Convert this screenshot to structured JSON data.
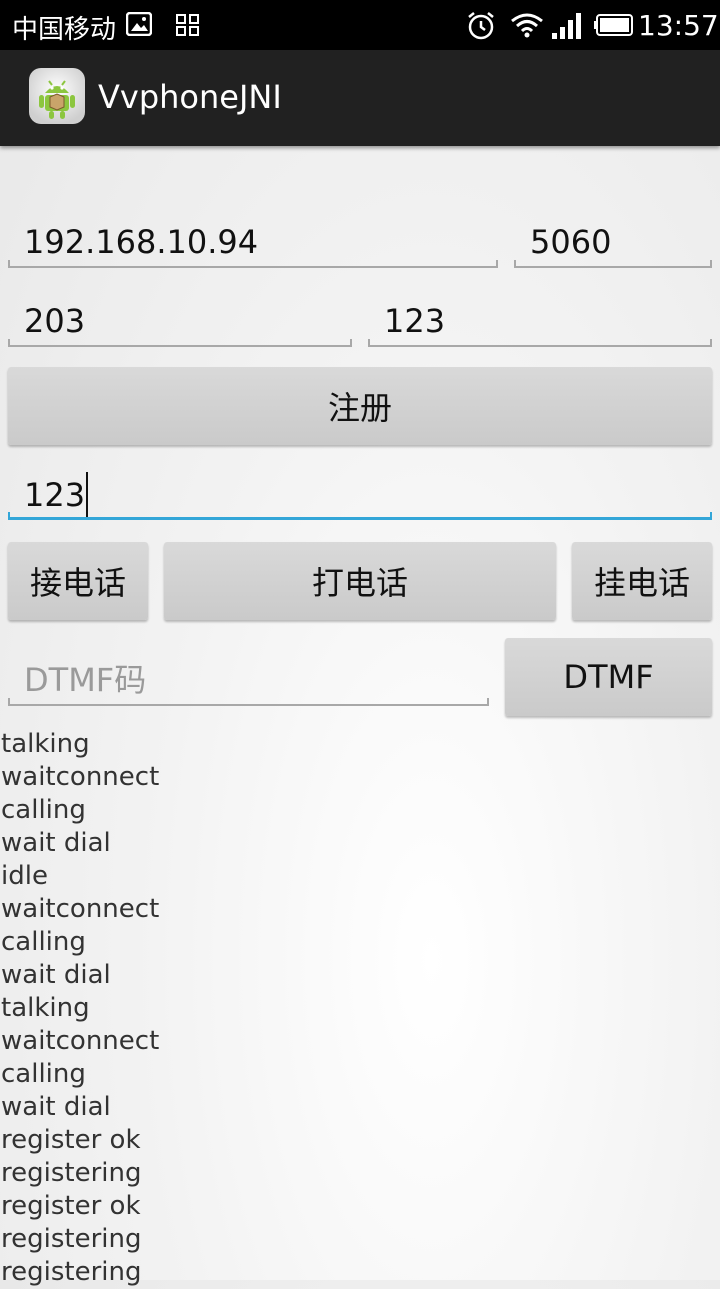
{
  "status_bar": {
    "carrier": "中国移动",
    "time": "13:57",
    "icons": [
      "image-icon",
      "grid-icon",
      "alarm-icon",
      "wifi-icon",
      "signal-icon",
      "battery-icon"
    ]
  },
  "action_bar": {
    "title": "VvphoneJNI",
    "icon": "android-app-icon"
  },
  "form": {
    "server_ip": "192.168.10.94",
    "server_port": "5060",
    "username": "203",
    "password": "123",
    "register_label": "注册",
    "dial_number": "123",
    "answer_label": "接电话",
    "call_label": "打电话",
    "hangup_label": "挂电话",
    "dtmf_placeholder": "DTMF码",
    "dtmf_label": "DTMF"
  },
  "log": [
    "talking",
    "waitconnect",
    "calling",
    "wait dial",
    "idle",
    "waitconnect",
    "calling",
    "wait dial",
    "talking",
    "waitconnect",
    "calling",
    "wait dial",
    "register ok",
    "registering",
    "register ok",
    "registering",
    "registering"
  ],
  "colors": {
    "focus_accent": "#33a6d8",
    "action_bar": "#212121",
    "status_bar": "#000000"
  }
}
